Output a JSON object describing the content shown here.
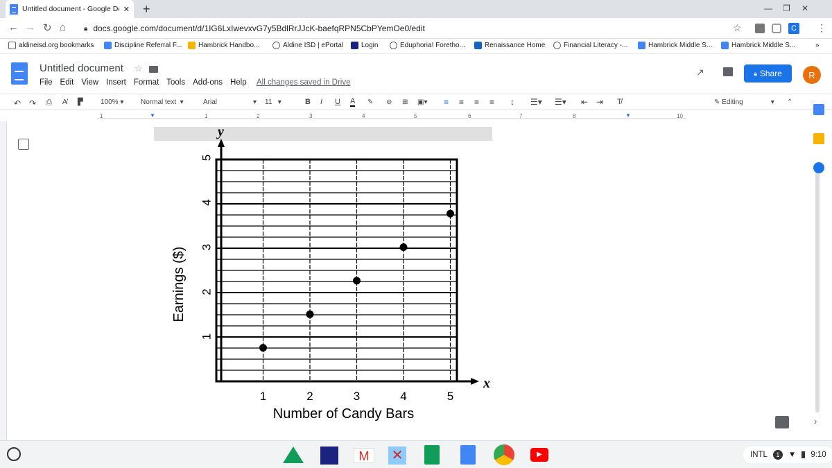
{
  "browser": {
    "tab_title": "Untitled document - Google Doc",
    "url": "docs.google.com/document/d/1IG6LxIwevxvG7y5BdlRrJJcK-baefqRPN5CbPYemOe0/edit"
  },
  "bookmarks": [
    {
      "label": "aldineisd.org bookmarks",
      "color": "#5f6368"
    },
    {
      "label": "Discipline Referral F...",
      "color": "#4285f4"
    },
    {
      "label": "Hambrick Handbo...",
      "color": "#f4b400"
    },
    {
      "label": "Aldine ISD | ePortal",
      "color": "#5f6368"
    },
    {
      "label": "Login",
      "color": "#1a237e"
    },
    {
      "label": "Eduphoria! Foretho...",
      "color": "#5f6368"
    },
    {
      "label": "Renaissance Home",
      "color": "#1565c0"
    },
    {
      "label": "Financial Literacy -...",
      "color": "#5f6368"
    },
    {
      "label": "Hambrick Middle S...",
      "color": "#4285f4"
    },
    {
      "label": "Hambrick Middle S...",
      "color": "#4285f4"
    }
  ],
  "doc": {
    "title": "Untitled document",
    "menus": [
      "File",
      "Edit",
      "View",
      "Insert",
      "Format",
      "Tools",
      "Add-ons",
      "Help"
    ],
    "saved_status": "All changes saved in Drive",
    "share_label": "Share",
    "avatar_letter": "R",
    "editing_label": "Editing"
  },
  "toolbar": {
    "zoom": "100%",
    "style": "Normal text",
    "font": "Arial",
    "size": "11"
  },
  "ruler": [
    "1",
    "1",
    "2",
    "3",
    "4",
    "5",
    "6",
    "7",
    "8",
    "10"
  ],
  "chart_data": {
    "type": "scatter",
    "x_axis_letter": "x",
    "y_axis_letter": "y",
    "xlabel": "Number of Candy Bars",
    "ylabel": "Earnings ($)",
    "xticks": [
      "1",
      "2",
      "3",
      "4",
      "5"
    ],
    "yticks": [
      "1",
      "2",
      "3",
      "4",
      "5"
    ],
    "x": [
      1,
      2,
      3,
      4,
      5
    ],
    "y": [
      0.75,
      1.5,
      2.25,
      3,
      3.75
    ],
    "xlim": [
      0,
      5
    ],
    "ylim": [
      0,
      5
    ],
    "grid": true
  },
  "system": {
    "keyboard": "INTL",
    "notification_count": "1",
    "time": "9:10"
  }
}
